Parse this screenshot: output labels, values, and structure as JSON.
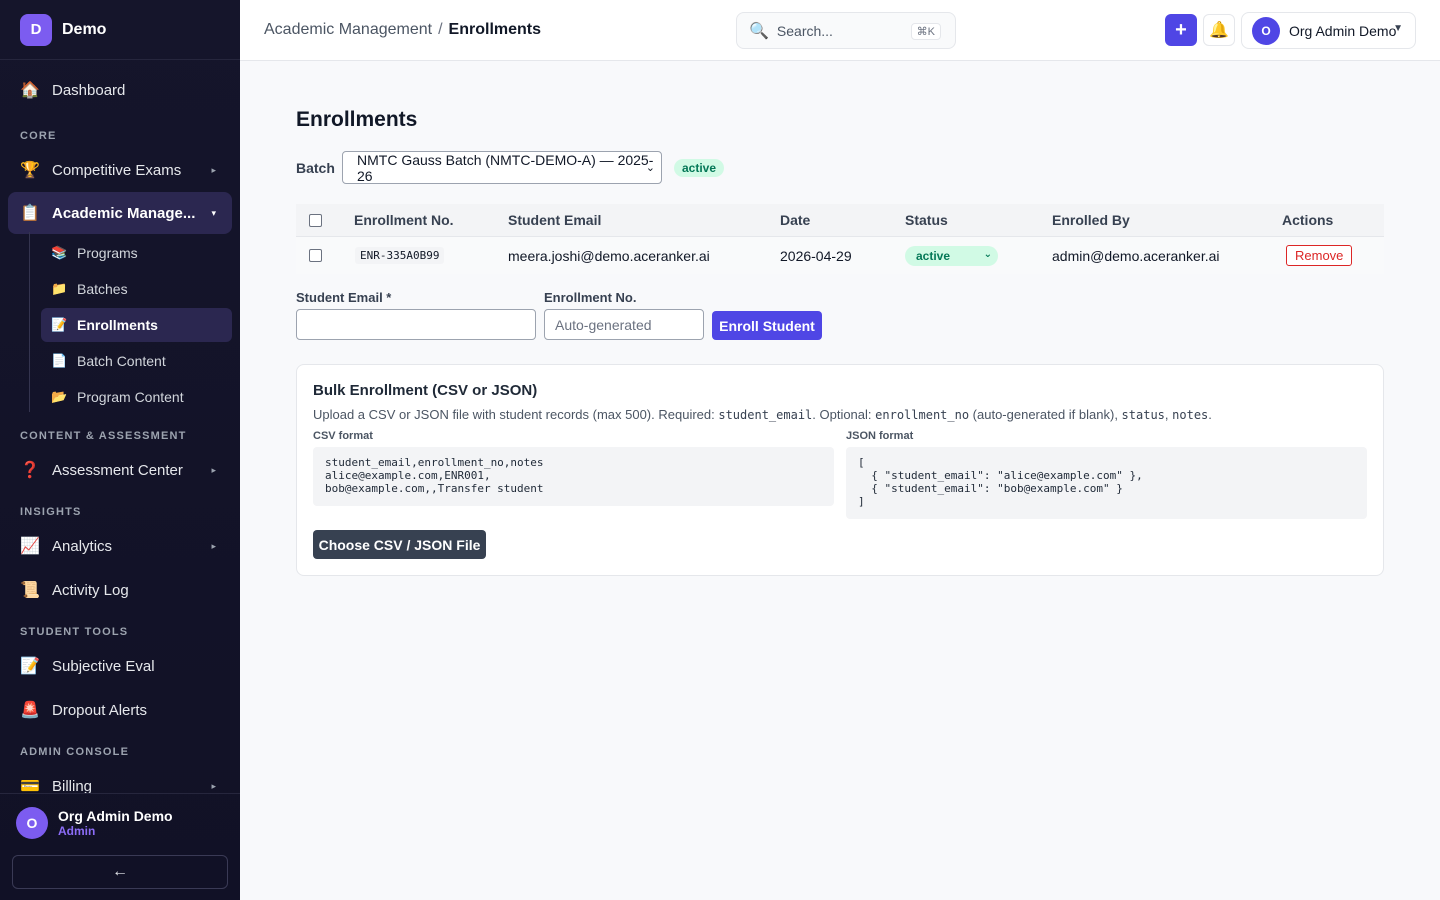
{
  "brand": {
    "logo_letter": "D",
    "name": "Demo"
  },
  "sidebar": {
    "dashboard": {
      "icon": "🏠",
      "label": "Dashboard"
    },
    "sections": {
      "core": "CORE",
      "content": "CONTENT & ASSESSMENT",
      "insights": "INSIGHTS",
      "student_tools": "STUDENT TOOLS",
      "admin": "ADMIN CONSOLE"
    },
    "competitive": {
      "icon": "🏆",
      "label": "Competitive Exams"
    },
    "academic": {
      "icon": "📋",
      "label": "Academic Manage..."
    },
    "sub": {
      "programs": {
        "icon": "📚",
        "label": "Programs"
      },
      "batches": {
        "icon": "📁",
        "label": "Batches"
      },
      "enrollments": {
        "icon": "📝",
        "label": "Enrollments"
      },
      "batch_content": {
        "icon": "📄",
        "label": "Batch Content"
      },
      "program_content": {
        "icon": "📂",
        "label": "Program Content"
      }
    },
    "assessment": {
      "icon": "❓",
      "label": "Assessment Center"
    },
    "analytics": {
      "icon": "📈",
      "label": "Analytics"
    },
    "activity": {
      "icon": "📜",
      "label": "Activity Log"
    },
    "subjective": {
      "icon": "📝",
      "label": "Subjective Eval"
    },
    "dropout": {
      "icon": "🚨",
      "label": "Dropout Alerts"
    },
    "billing": {
      "icon": "💳",
      "label": "Billing"
    },
    "caret": "▸",
    "caret_open": "▾",
    "user": {
      "avatar": "O",
      "name": "Org Admin Demo",
      "role": "Admin"
    },
    "collapse": "←"
  },
  "header": {
    "breadcrumb_parent": "Academic Management",
    "breadcrumb_sep": "/",
    "breadcrumb_current": "Enrollments",
    "search_icon": "🔍",
    "search_placeholder": "Search...",
    "search_shortcut": "⌘K",
    "plus": "+",
    "bell": "🔔",
    "user_avatar": "O",
    "user_name": "Org Admin Demo",
    "user_caret": "▼"
  },
  "page": {
    "title": "Enrollments",
    "batch_label": "Batch",
    "batch_value": "NMTC Gauss Batch (NMTC-DEMO-A) — 2025-26",
    "batch_caret": "⌄",
    "batch_status": "active"
  },
  "table": {
    "columns": [
      "Enrollment No.",
      "Student Email",
      "Date",
      "Status",
      "Enrolled By",
      "Actions"
    ],
    "rows": [
      {
        "enrollment_no": "ENR-335A0B99",
        "email": "meera.joshi@demo.aceranker.ai",
        "date": "2026-04-29",
        "status": "active",
        "enrolled_by": "admin@demo.aceranker.ai",
        "action": "Remove"
      }
    ],
    "status_caret": "⌄"
  },
  "form": {
    "email_label": "Student Email *",
    "email_value": "",
    "enroll_no_label": "Enrollment No.",
    "enroll_no_placeholder": "Auto-generated",
    "submit": "Enroll Student"
  },
  "bulk": {
    "title": "Bulk Enrollment (CSV or JSON)",
    "desc_1": "Upload a CSV or JSON file with student records (max 500). Required: ",
    "code_1": "student_email",
    "desc_2": ". Optional: ",
    "code_2": "enrollment_no",
    "desc_3": " (auto-generated if blank), ",
    "code_3": "status",
    "desc_4": ", ",
    "code_4": "notes",
    "desc_5": ".",
    "csv_label": "CSV format",
    "csv_sample": "student_email,enrollment_no,notes\nalice@example.com,ENR001,\nbob@example.com,,Transfer student",
    "json_label": "JSON format",
    "json_sample": "[\n  { \"student_email\": \"alice@example.com\" },\n  { \"student_email\": \"bob@example.com\" }\n]",
    "choose_button": "Choose CSV / JSON File"
  },
  "colors": {
    "accent": "#4f46e5",
    "sidebar_bg": "#15152b",
    "active_green_bg": "#d1fae5",
    "active_green_text": "#047857",
    "danger": "#dc2626"
  }
}
